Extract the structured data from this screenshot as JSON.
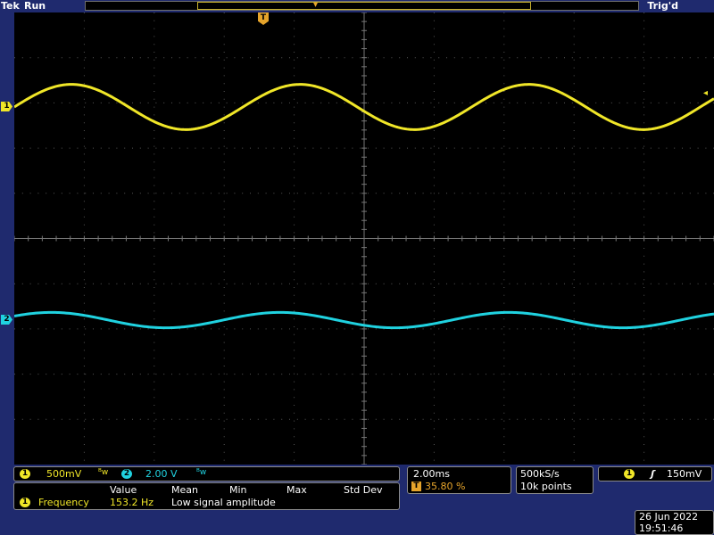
{
  "header": {
    "brand": "Tek",
    "run_state": "Run",
    "trigger_status": "Trig'd"
  },
  "markers": {
    "ch1": "1",
    "ch2": "2",
    "trigger_position": "T"
  },
  "channels": {
    "ch1": {
      "number": "1",
      "scale": "500mV",
      "color": "#f0e628",
      "bw_symbol": "ᴮw"
    },
    "ch2": {
      "number": "2",
      "scale": "2.00 V",
      "color": "#20d2e0",
      "bw_symbol": "ᴮw"
    }
  },
  "measurements": {
    "headers": [
      "Value",
      "Mean",
      "Min",
      "Max",
      "Std Dev"
    ],
    "row": {
      "channel": "1",
      "name": "Frequency",
      "value": "153.2 Hz",
      "note": "Low signal amplitude"
    }
  },
  "timebase": {
    "scale": "2.00ms",
    "trigger_position_icon": "T",
    "trigger_position": "35.80 %"
  },
  "acquisition": {
    "sample_rate": "500kS/s",
    "record_length": "10k points"
  },
  "trigger": {
    "source": "1",
    "slope_icon": "rising-edge-icon",
    "slope_symbol": "⅀",
    "level": "150mV"
  },
  "datetime": {
    "date": "26 Jun  2022",
    "time": "19:51:46"
  },
  "colors": {
    "ch1": "#f0e628",
    "ch2": "#20d2e0",
    "trigger": "#e6a42b",
    "frame": "#1f2a6e"
  },
  "waveforms": {
    "ch1": {
      "cycles_on_screen": 3.06,
      "amplitude_div": 0.5,
      "offset_div": 0.0
    },
    "ch2": {
      "cycles_on_screen": 3.06,
      "amplitude_div": 0.17,
      "offset_div": 0.0
    }
  }
}
